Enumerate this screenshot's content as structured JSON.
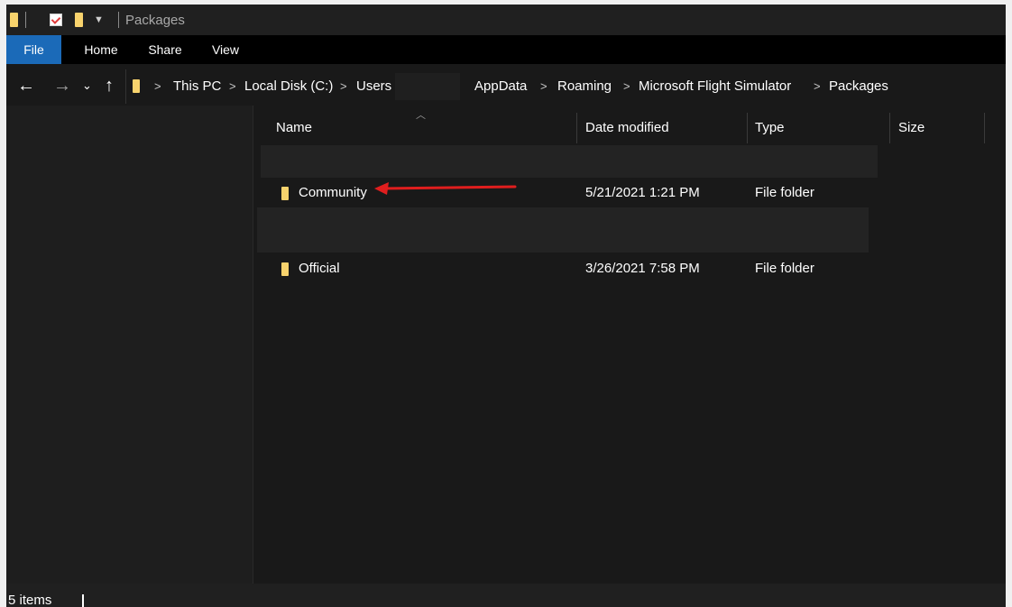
{
  "window": {
    "title": "Packages"
  },
  "ribbon": {
    "tabs": [
      "File",
      "Home",
      "Share",
      "View"
    ]
  },
  "address": {
    "crumbs": [
      "This PC",
      "Local Disk (C:)",
      "Users",
      "AppData",
      "Roaming",
      "Microsoft Flight Simulator",
      "Packages"
    ]
  },
  "columns": {
    "name": "Name",
    "date": "Date modified",
    "type": "Type",
    "size": "Size"
  },
  "files": [
    {
      "name": "Community",
      "date": "5/21/2021 1:21 PM",
      "type": "File folder"
    },
    {
      "name": "Official",
      "date": "3/26/2021 7:58 PM",
      "type": "File folder"
    }
  ],
  "status": {
    "items": "5 items"
  },
  "colors": {
    "folder": "#f8d36d",
    "file_tab": "#1b6ab8",
    "annotation_arrow": "#e01e1e"
  },
  "icons": [
    "folder-icon",
    "check-icon",
    "back-arrow-icon",
    "forward-arrow-icon",
    "recent-dropdown-icon",
    "up-arrow-icon",
    "sort-ascending-icon",
    "chevron-right-icon"
  ]
}
